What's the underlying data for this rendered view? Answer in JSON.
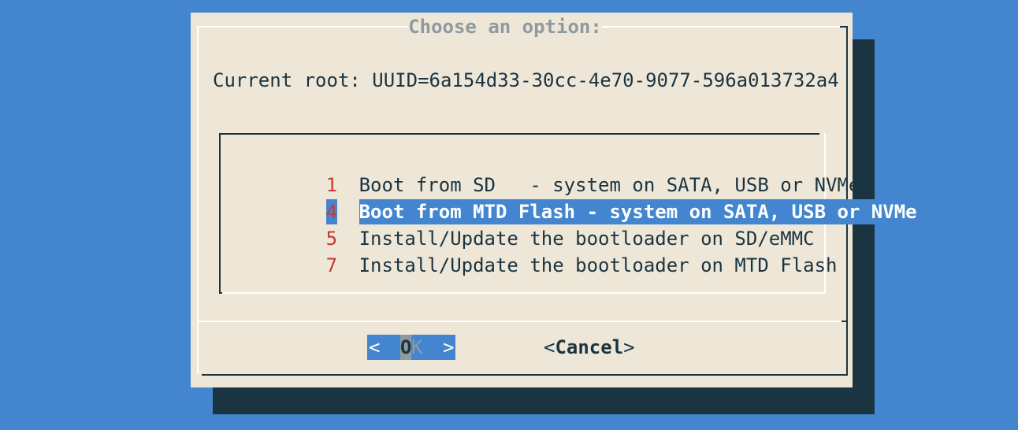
{
  "dialog": {
    "title": "Choose an option:",
    "current_root": "Current root: UUID=6a154d33-30cc-4e70-9077-596a013732a4"
  },
  "menu": {
    "items": [
      {
        "tag": "1",
        "label": "Boot from SD   - system on SATA, USB or NVMe",
        "selected": false
      },
      {
        "tag": "4",
        "label": "Boot from MTD Flash - system on SATA, USB or NVMe",
        "selected": true
      },
      {
        "tag": "5",
        "label": "Install/Update the bootloader on SD/eMMC",
        "selected": false
      },
      {
        "tag": "7",
        "label": "Install/Update the bootloader on MTD Flash",
        "selected": false
      }
    ]
  },
  "buttons": {
    "ok": {
      "open": "<",
      "first": "O",
      "rest": "K",
      "close": ">"
    },
    "cancel": {
      "open": "<",
      "label": "Cancel",
      "close": ">"
    }
  },
  "colors": {
    "background": "#4386cf",
    "dialog": "#eee7d8",
    "shadow": "#1b3441",
    "tag": "#c9382e",
    "title": "#8e9a9f",
    "selection": "#4386cf"
  }
}
